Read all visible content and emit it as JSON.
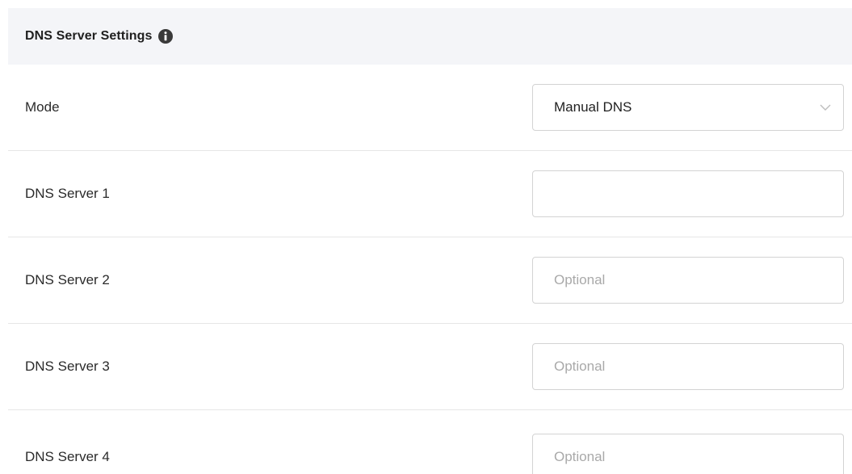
{
  "header": {
    "title": "DNS Server Settings",
    "info_icon": "info-circle-icon"
  },
  "mode": {
    "label": "Mode",
    "selected_value": "Manual DNS"
  },
  "dns_servers": [
    {
      "label": "DNS Server 1",
      "value": "",
      "placeholder": ""
    },
    {
      "label": "DNS Server 2",
      "value": "",
      "placeholder": "Optional"
    },
    {
      "label": "DNS Server 3",
      "value": "",
      "placeholder": "Optional"
    },
    {
      "label": "DNS Server 4",
      "value": "",
      "placeholder": "Optional"
    }
  ],
  "colors": {
    "header_bg": "#f4f5f8",
    "divider": "#e6e6e6",
    "field_border": "#d3d3d3",
    "placeholder": "#a9a9a9",
    "text": "#2b2b2b"
  }
}
